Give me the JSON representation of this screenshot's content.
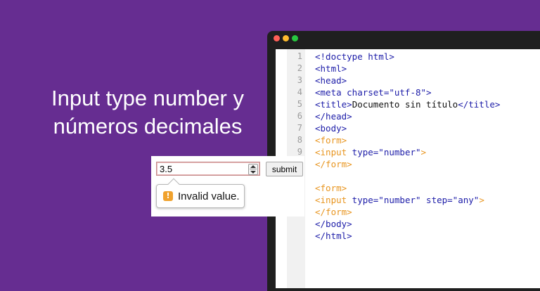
{
  "headline": {
    "line1": "Input type number y",
    "line2": "números decimales"
  },
  "colors": {
    "background": "#662d91",
    "frame": "#1f1f1f",
    "tag": "#1c1ca8",
    "form_tag": "#e8951f"
  },
  "editor": {
    "line_numbers": [
      "1",
      "2",
      "3",
      "4",
      "5",
      "6",
      "7",
      "8",
      "9"
    ],
    "lines": [
      "<!doctype html>",
      "<html>",
      "<head>",
      "<meta charset=\"utf-8\">",
      "<title>Documento sin título</title>",
      "</head>",
      "<body>",
      "<form>",
      "<input type=\"number\">",
      "</form>",
      "",
      "<form>",
      "<input type=\"number\" step=\"any\">",
      "</form>",
      "</body>",
      "</html>"
    ]
  },
  "form_demo": {
    "input_value": "3.5",
    "submit_label": "submit",
    "validation_message": "Invalid value.",
    "warning_icon": "warning-icon"
  }
}
